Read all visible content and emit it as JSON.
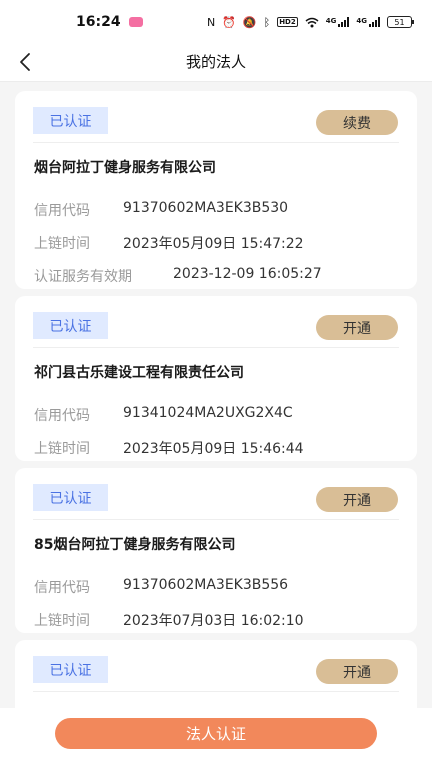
{
  "status_bar": {
    "time": "16:24",
    "nfc_icon": "N",
    "alarm_icon": "⏰",
    "mute_icon": "🔕",
    "bluetooth_icon": "ᛒ",
    "hd_label": "HD2",
    "wifi_icon": "wifi",
    "signal_1_label": "4G",
    "signal_2_label": "4G",
    "battery_level": "51"
  },
  "header": {
    "title": "我的法人"
  },
  "cards": [
    {
      "badge": "已认证",
      "action": "续费",
      "company": "烟台阿拉丁健身服务有限公司",
      "rows": [
        {
          "label": "信用代码",
          "value": "91370602MA3EK3B530"
        },
        {
          "label": "上链时间",
          "value": "2023年05月09日 15:47:22"
        },
        {
          "label": "认证服务有效期",
          "value": "2023-12-09 16:05:27"
        }
      ]
    },
    {
      "badge": "已认证",
      "action": "开通",
      "company": "祁门县古乐建设工程有限责任公司",
      "rows": [
        {
          "label": "信用代码",
          "value": "91341024MA2UXG2X4C"
        },
        {
          "label": "上链时间",
          "value": "2023年05月09日 15:46:44"
        }
      ]
    },
    {
      "badge": "已认证",
      "action": "开通",
      "company": "85烟台阿拉丁健身服务有限公司",
      "rows": [
        {
          "label": "信用代码",
          "value": "91370602MA3EK3B556"
        },
        {
          "label": "上链时间",
          "value": "2023年07月03日 16:02:10"
        }
      ]
    },
    {
      "badge": "已认证",
      "action": "开通"
    }
  ],
  "footer": {
    "button_label": "法人认证"
  },
  "colors": {
    "badge_bg": "#e0eaff",
    "badge_text": "#4a72e3",
    "action_bg": "#d9be96",
    "primary": "#f2885b"
  }
}
